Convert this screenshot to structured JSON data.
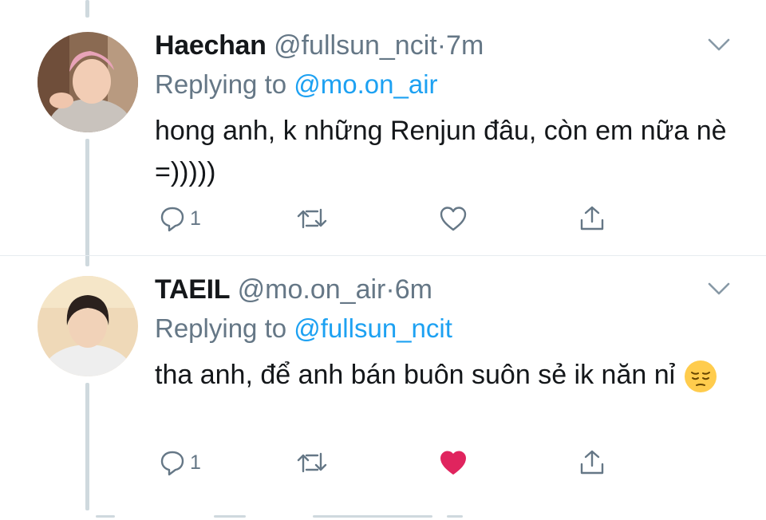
{
  "tweets": [
    {
      "name": "Haechan",
      "handle": "@fullsun_ncit",
      "separator": "·",
      "time": "7m",
      "reply_prefix": "Replying to",
      "reply_to": "@mo.on_air",
      "text": "hong anh, k những Renjun đâu, còn em nữa nè =)))))",
      "reply_count": "1",
      "liked": false
    },
    {
      "name": "TAEIL",
      "handle": "@mo.on_air",
      "separator": "·",
      "time": "6m",
      "reply_prefix": "Replying to",
      "reply_to": "@fullsun_ncit",
      "text": "tha anh, để anh bán buôn suôn sẻ ik năn nỉ",
      "emoji": "pensive-face",
      "reply_count": "1",
      "liked": true
    }
  ],
  "icons": {
    "reply": "reply-icon",
    "retweet": "retweet-icon",
    "like": "heart-icon",
    "share": "share-icon",
    "more": "chevron-down-icon"
  },
  "colors": {
    "name": "#14171a",
    "secondary": "#657786",
    "mention": "#1da1f2",
    "liked_heart": "#e0245e",
    "thread_line": "#cfd9de"
  }
}
